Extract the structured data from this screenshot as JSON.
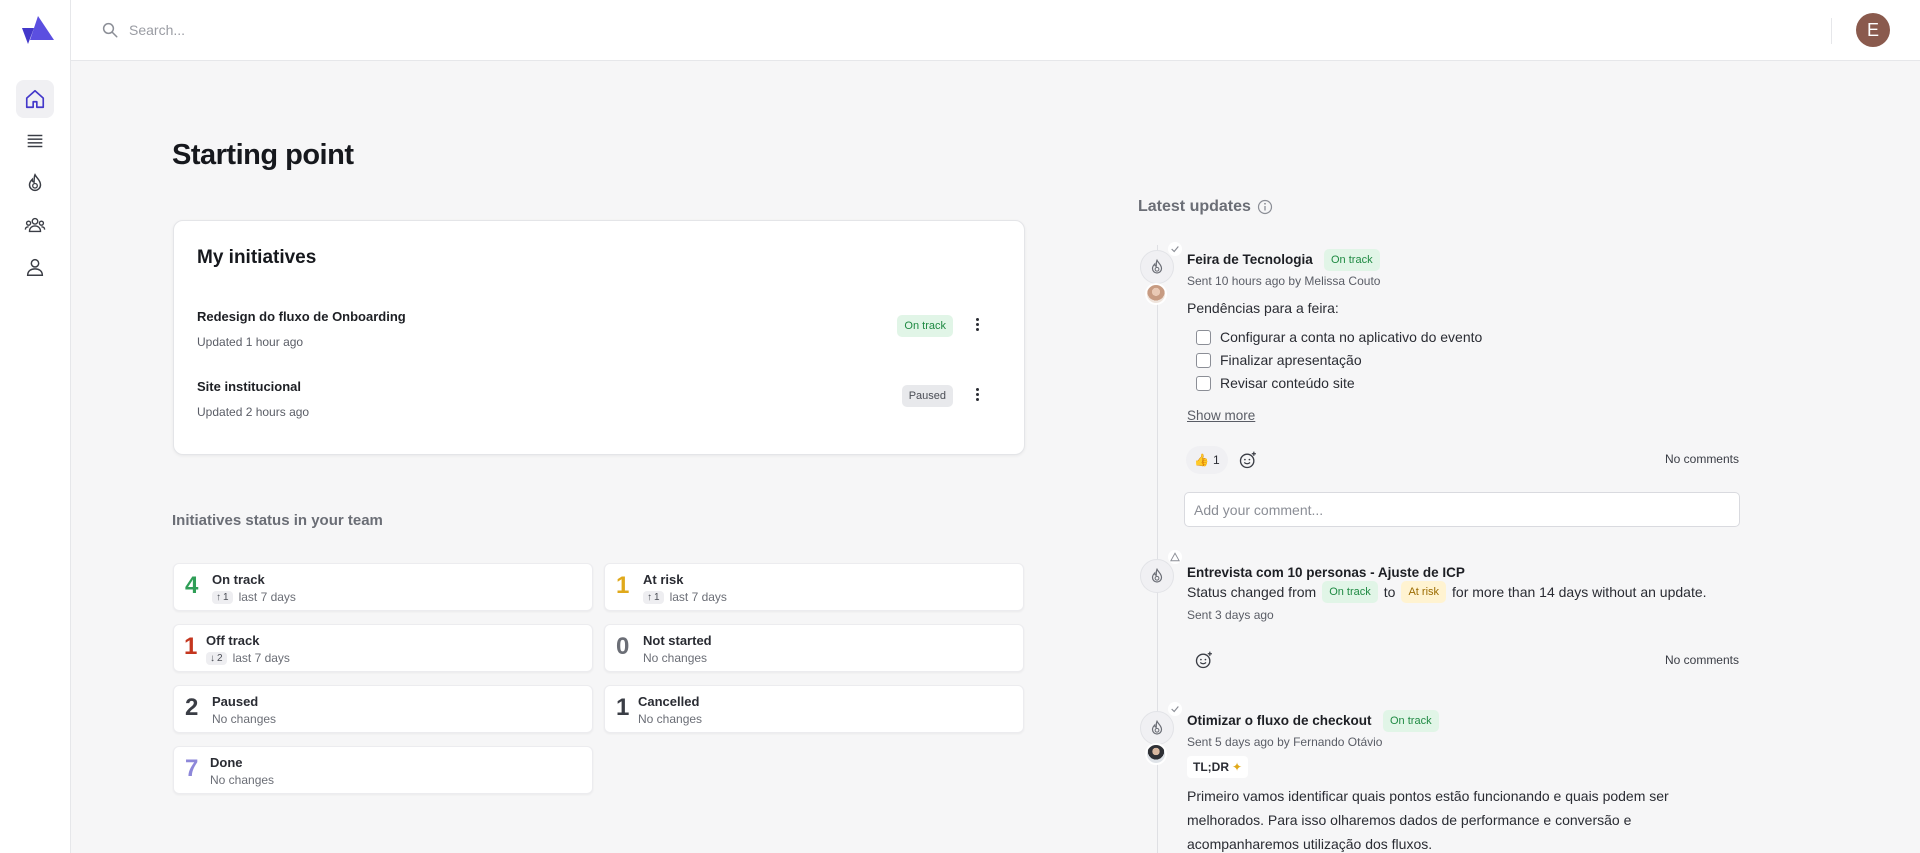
{
  "topbar": {
    "search_placeholder": "Search...",
    "avatar_initial": "E"
  },
  "sidebar": {
    "items": [
      {
        "name": "home",
        "icon": "home-icon",
        "active": true
      },
      {
        "name": "list",
        "icon": "list-icon",
        "active": false
      },
      {
        "name": "initiatives",
        "icon": "flame-icon",
        "active": false
      },
      {
        "name": "teams",
        "icon": "team-icon",
        "active": false
      },
      {
        "name": "profile",
        "icon": "person-icon",
        "active": false
      }
    ]
  },
  "page": {
    "title": "Starting point"
  },
  "my_initiatives": {
    "title": "My initiatives",
    "items": [
      {
        "name": "Redesign do fluxo de Onboarding",
        "updated": "Updated 1 hour ago",
        "status": "On track"
      },
      {
        "name": "Site institucional",
        "updated": "Updated 2 hours ago",
        "status": "Paused"
      }
    ]
  },
  "team_status": {
    "title": "Initiatives status in your team",
    "cards": [
      {
        "count": "4",
        "label": "On track",
        "delta": "1",
        "delta_dir": "up",
        "sub": "last 7 days",
        "color": "#2f9e57"
      },
      {
        "count": "1",
        "label": "At risk",
        "delta": "1",
        "delta_dir": "up",
        "sub": "last 7 days",
        "color": "#e0a91b"
      },
      {
        "count": "1",
        "label": "Off track",
        "delta": "2",
        "delta_dir": "down",
        "sub": "last 7 days",
        "color": "#c4361f"
      },
      {
        "count": "0",
        "label": "Not started",
        "delta": "",
        "sub": "No changes",
        "color": "#6b6e76"
      },
      {
        "count": "2",
        "label": "Paused",
        "delta": "",
        "sub": "No changes",
        "color": "#3a3d45"
      },
      {
        "count": "1",
        "label": "Cancelled",
        "delta": "",
        "sub": "No changes",
        "color": "#3a3d45"
      },
      {
        "count": "7",
        "label": "Done",
        "delta": "",
        "sub": "No changes",
        "color": "#8d87d9"
      }
    ]
  },
  "latest_updates": {
    "title": "Latest updates",
    "items": [
      {
        "title": "Feira de Tecnologia",
        "status": "On track",
        "meta": "Sent 10 hours ago by Melissa Couto",
        "intro": "Pendências para a feira:",
        "checklist": [
          "Configurar a conta no aplicativo do evento",
          "Finalizar apresentação",
          "Revisar conteúdo site"
        ],
        "show_more": "Show more",
        "reaction_emoji": "👍",
        "reaction_count": "1",
        "comments": "No comments",
        "comment_placeholder": "Add your comment..."
      },
      {
        "title": "Entrevista com 10 personas - Ajuste de ICP",
        "text_prefix": "Status changed from",
        "from_status": "On track",
        "text_to": "to",
        "to_status": "At risk",
        "text_suffix": "for more than 14 days without an update.",
        "meta": "Sent 3 days ago",
        "comments": "No comments"
      },
      {
        "title": "Otimizar o fluxo de checkout",
        "status": "On track",
        "meta": "Sent 5 days ago by Fernando Otávio",
        "tldr": "TL;DR",
        "body": "Primeiro vamos identificar quais pontos estão funcionando e quais podem ser melhorados. Para isso olharemos dados de performance e conversão e acompanharemos utilização dos fluxos."
      }
    ]
  },
  "colors": {
    "brand": "#5b4fe0",
    "on_track_bg": "#e1f5e7",
    "at_risk_bg": "#fff3d1"
  }
}
